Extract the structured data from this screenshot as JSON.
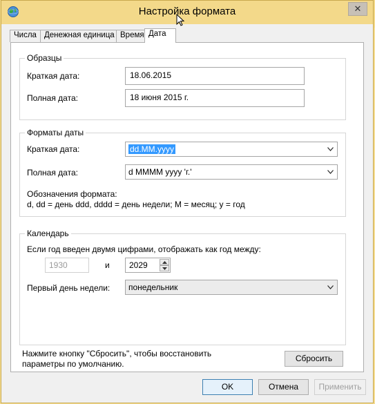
{
  "window": {
    "title": "Настройка формата"
  },
  "tabs": [
    {
      "label": "Числа"
    },
    {
      "label": "Денежная единица"
    },
    {
      "label": "Время"
    },
    {
      "label": "Дата"
    }
  ],
  "samples": {
    "legend": "Образцы",
    "short_label": "Краткая дата:",
    "short_value": "18.06.2015",
    "long_label": "Полная дата:",
    "long_value": "18 июня 2015 г."
  },
  "formats": {
    "legend": "Форматы даты",
    "short_label": "Краткая дата:",
    "short_value": "dd.MM.yyyy",
    "long_label": "Полная дата:",
    "long_value": "d MMMM yyyy 'г.'",
    "notation_title": "Обозначения формата:",
    "notation_text": "d, dd = день  ddd, dddd = день недели; M = месяц; y = год"
  },
  "calendar": {
    "legend": "Календарь",
    "two_digit_label": "Если год введен двумя цифрами, отображать как год между:",
    "year_from": "1930",
    "and_label": "и",
    "year_to": "2029",
    "first_day_label": "Первый день недели:",
    "first_day_value": "понедельник"
  },
  "reset": {
    "hint": "Нажмите кнопку \"Сбросить\", чтобы восстановить параметры по умолчанию.",
    "button": "Сбросить"
  },
  "footer": {
    "ok": "OK",
    "cancel": "Отмена",
    "apply": "Применить"
  },
  "colors": {
    "accent": "#3399ff",
    "titlebar": "#f3d98a"
  }
}
